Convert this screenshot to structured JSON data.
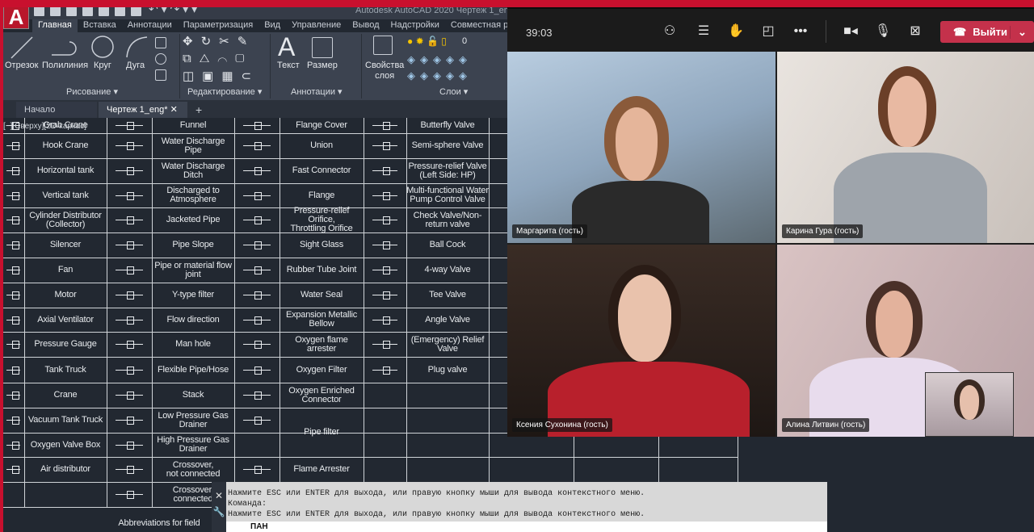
{
  "autocad": {
    "logo": "A",
    "title": "Autodesk AutoCAD 2020   Чертеж 1_eng",
    "ribbon_tabs": [
      "Главная",
      "Вставка",
      "Аннотации",
      "Параметризация",
      "Вид",
      "Управление",
      "Вывод",
      "Надстройки",
      "Совместная рабо"
    ],
    "active_tab": "Главная",
    "tools": {
      "line": "Отрезок",
      "polyline": "Полилиния",
      "circle": "Круг",
      "arc": "Дуга",
      "text": "Текст",
      "dimension": "Размер",
      "layer_props": "Свойства\nслоя",
      "layer_value": "0"
    },
    "panels": {
      "draw": "Рисование ▾",
      "modify": "Редактирование ▾",
      "annotation": "Аннотации ▾",
      "layers": "Слои ▾"
    },
    "doc_tabs": [
      "Начало",
      "Чертеж 1_eng*"
    ],
    "view_label": "[−][Сверху][2D-каркас]",
    "table_rows": [
      [
        "Grab Crane",
        "Funnel",
        "Flange Cover",
        "Butterfly Valve"
      ],
      [
        "Hook Crane",
        "Water Discharge Pipe",
        "Union",
        "Semi-sphere Valve"
      ],
      [
        "Horizontal tank",
        "Water Discharge Ditch",
        "Fast Connector",
        "Pressure-relief Valve\n(Left Side: HP)"
      ],
      [
        "Vertical tank",
        "Discharged to Atmosphere",
        "Flange",
        "Multi-functional Water\nPump Control Valve"
      ],
      [
        "Cylinder Distributor (Collector)",
        "Jacketed Pipe",
        "Pressure-relief Orifice,\nThrottling Orifice",
        "Check Valve/Non-return valve"
      ],
      [
        "Silencer",
        "Pipe Slope",
        "Sight Glass",
        "Ball Cock"
      ],
      [
        "Fan",
        "Pipe or material flow joint",
        "Rubber Tube Joint",
        "4-way Valve"
      ],
      [
        "Motor",
        "Y-type filter",
        "Water Seal",
        "Tee Valve"
      ],
      [
        "Axial Ventilator",
        "Flow direction",
        "Expansion Metallic Bellow",
        "Angle Valve"
      ],
      [
        "Pressure Gauge",
        "Man hole",
        "Oxygen flame arrester",
        "(Emergency) Relief Valve"
      ],
      [
        "Tank Truck",
        "Flexible Pipe/Hose",
        "Oxygen Filter",
        "Plug valve"
      ],
      [
        "Crane",
        "Stack",
        "Oxygen Enriched Connector",
        ""
      ],
      [
        "Vacuum Tank Truck",
        "Low Pressure Gas Drainer",
        "Pipe filter",
        ""
      ],
      [
        "Oxygen Valve Box",
        "High Pressure Gas Drainer",
        "",
        ""
      ],
      [
        "Air distributor",
        "Crossover,\nnot connected",
        "Flame Arrester",
        ""
      ],
      [
        "",
        "Crossover,\nconnected",
        "",
        ""
      ]
    ],
    "abbreviations": "Abbreviations for field",
    "command_lines": [
      "Нажмите ESC или ENTER для выхода, или правую кнопку мыши для вывода контекстного меню.",
      "Команда:",
      "Нажмите ESC или ENTER для выхода, или правую кнопку мыши для вывода контекстного меню."
    ],
    "command_input": "ПАН"
  },
  "teams": {
    "timer": "39:03",
    "leave_label": "Выйти",
    "leave_color": "#c4314b",
    "participants": [
      "Маргарита (гость)",
      "Карина Гура (гость)",
      "Ксения Сухонина (гость)",
      "Алина Литвин (гость)"
    ],
    "toolbar_icons": [
      "participants-icon",
      "chat-icon",
      "raise-hand-icon",
      "rooms-icon",
      "more-icon",
      "camera-icon",
      "microphone-icon",
      "share-screen-icon"
    ]
  }
}
